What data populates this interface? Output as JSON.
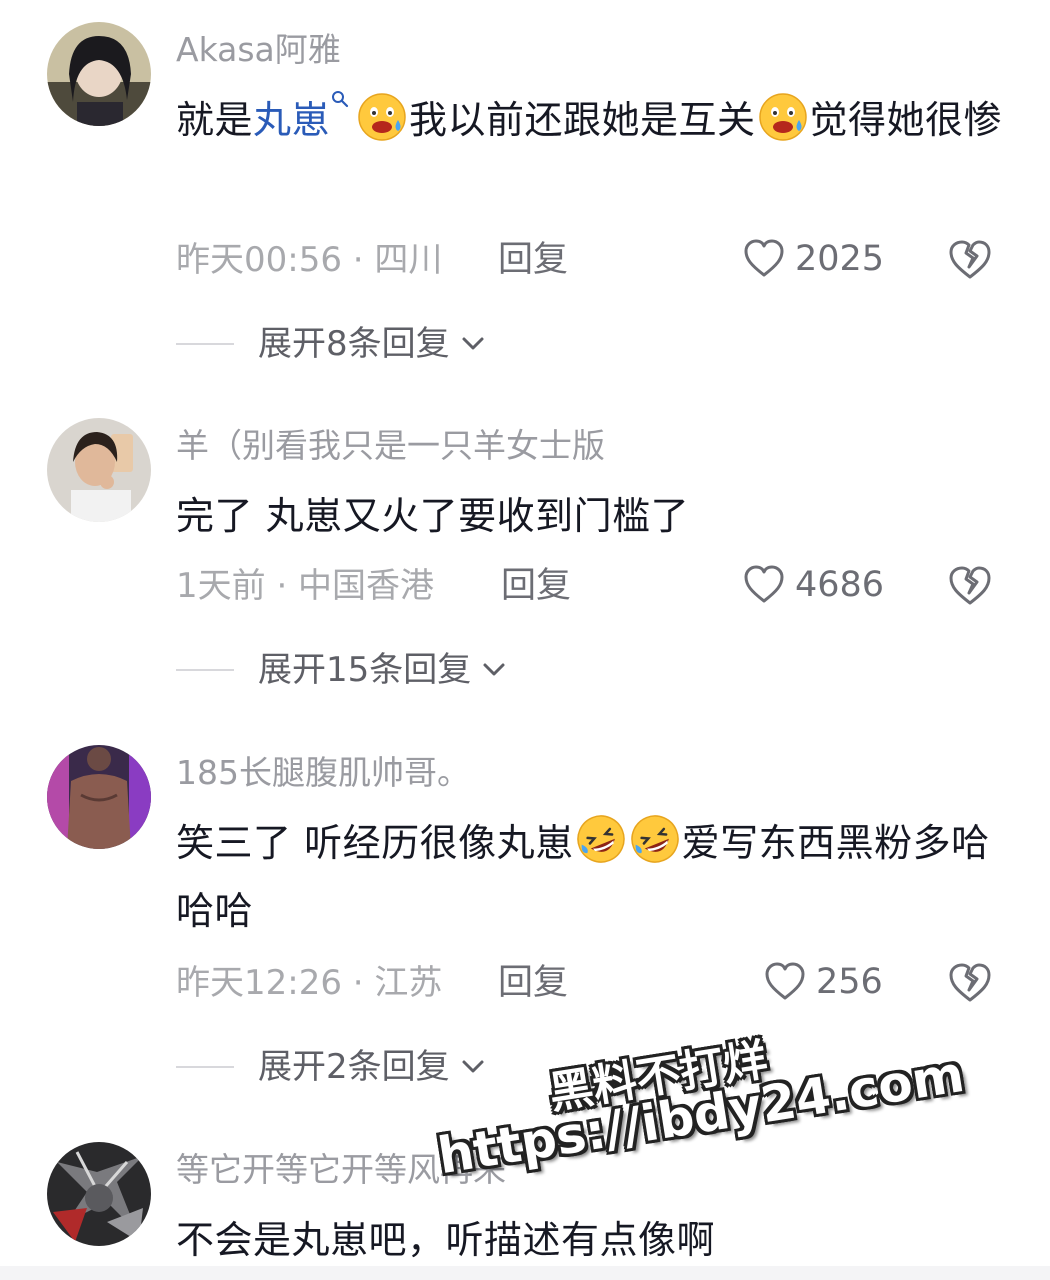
{
  "comments": [
    {
      "username": "Akasa阿雅",
      "content_parts": [
        "就是",
        "丸崽",
        "我以前还跟她是互关",
        "觉得她很惨"
      ],
      "time": "昨天00:56 · 四川",
      "reply_label": "回复",
      "likes": "2025",
      "expand_label": "展开8条回复"
    },
    {
      "username": "羊（别看我只是一只羊女士版",
      "content": "完了 丸崽又火了要收到门槛了",
      "time": "1天前 · 中国香港",
      "reply_label": "回复",
      "likes": "4686",
      "expand_label": "展开15条回复"
    },
    {
      "username": "185长腿腹肌帅哥。",
      "content_parts": [
        "笑三了 听经历很像丸崽",
        "爱写东西黑粉多哈哈哈"
      ],
      "time": "昨天12:26 · 江苏",
      "reply_label": "回复",
      "likes": "256",
      "expand_label": "展开2条回复"
    },
    {
      "username": "等它开等它开等风再来",
      "content": "不会是丸崽吧，听描述有点像啊"
    }
  ],
  "watermark": {
    "line1": "黑料不打烊",
    "line2": "https://ibdy24.com"
  },
  "icons": {
    "like": "heart-outline-icon",
    "dislike": "broken-heart-icon",
    "expand": "chevron-down-icon",
    "mention": "search-icon",
    "emoji1": "fearful-face-emoji",
    "emoji2": "rolling-laughing-emoji"
  }
}
